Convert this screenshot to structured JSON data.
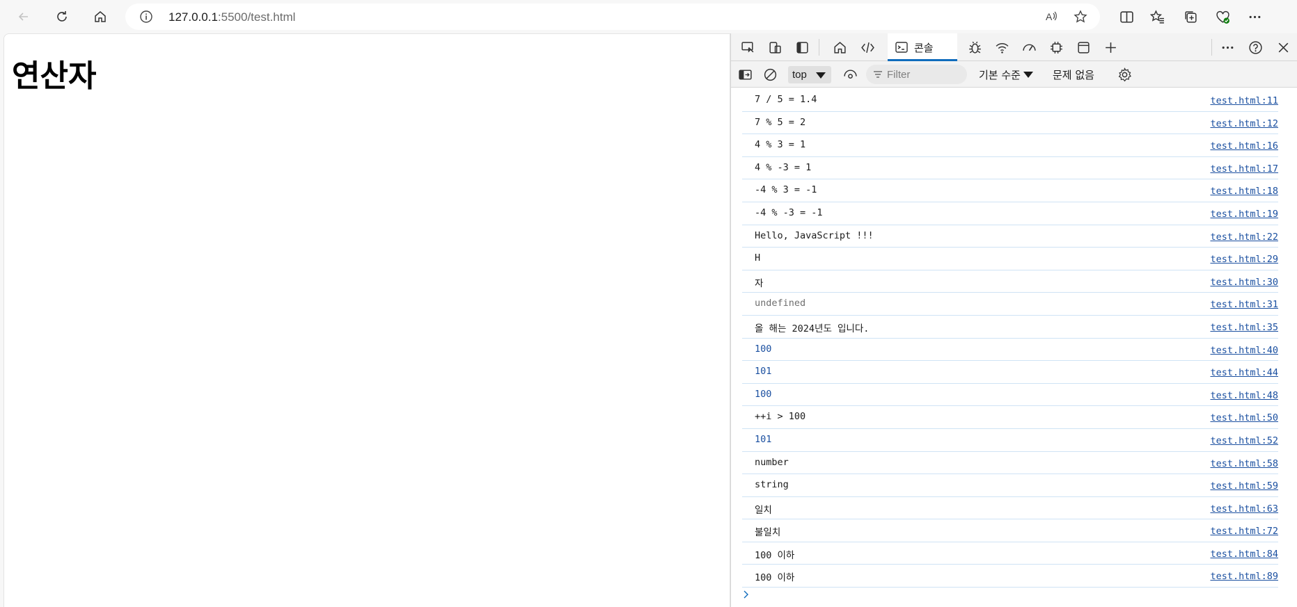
{
  "browser": {
    "url_host": "127.0.0.1",
    "url_rest": ":5500/test.html",
    "icons": [
      "back-icon",
      "refresh-icon",
      "home-icon",
      "site-info-icon",
      "read-aloud-icon",
      "favorite-star-icon",
      "split-screen-icon",
      "favorites-icon",
      "collections-icon",
      "browser-essentials-icon",
      "more-icon"
    ]
  },
  "page": {
    "title": "연산자"
  },
  "devtools": {
    "active_tab": "콘솔",
    "toolbar": {
      "context": "top",
      "filter_placeholder": "Filter",
      "levels": "기본 수준",
      "issues": "문제 없음"
    },
    "console": [
      {
        "text": "7 / 5 = 1.4",
        "source": "test.html:11",
        "kind": "text"
      },
      {
        "text": "7 % 5 = 2",
        "source": "test.html:12",
        "kind": "text"
      },
      {
        "text": "4 % 3 = 1",
        "source": "test.html:16",
        "kind": "text"
      },
      {
        "text": "4 % -3 = 1",
        "source": "test.html:17",
        "kind": "text"
      },
      {
        "text": "-4 % 3 = -1",
        "source": "test.html:18",
        "kind": "text"
      },
      {
        "text": "-4 % -3 = -1",
        "source": "test.html:19",
        "kind": "text"
      },
      {
        "text": "Hello, JavaScript !!!",
        "source": "test.html:22",
        "kind": "text"
      },
      {
        "text": "H",
        "source": "test.html:29",
        "kind": "text"
      },
      {
        "text": "자",
        "source": "test.html:30",
        "kind": "text"
      },
      {
        "text": "undefined",
        "source": "test.html:31",
        "kind": "undefined"
      },
      {
        "text": "올 해는 2024년도 입니다.",
        "source": "test.html:35",
        "kind": "text"
      },
      {
        "text": "100",
        "source": "test.html:40",
        "kind": "number"
      },
      {
        "text": "101",
        "source": "test.html:44",
        "kind": "number"
      },
      {
        "text": "100",
        "source": "test.html:48",
        "kind": "number"
      },
      {
        "text": "++i > 100",
        "source": "test.html:50",
        "kind": "text"
      },
      {
        "text": "101",
        "source": "test.html:52",
        "kind": "number"
      },
      {
        "text": "number",
        "source": "test.html:58",
        "kind": "text"
      },
      {
        "text": "string",
        "source": "test.html:59",
        "kind": "text"
      },
      {
        "text": "일치",
        "source": "test.html:63",
        "kind": "text"
      },
      {
        "text": "불일치",
        "source": "test.html:72",
        "kind": "text"
      },
      {
        "text": "100 이하",
        "source": "test.html:84",
        "kind": "text"
      },
      {
        "text": "100 이하",
        "source": "test.html:89",
        "kind": "text"
      }
    ],
    "colors": {
      "accent": "#0f6cbd",
      "number": "#1a4fa0",
      "link": "#1a4fa0",
      "row_border": "#cfe3f5"
    }
  }
}
